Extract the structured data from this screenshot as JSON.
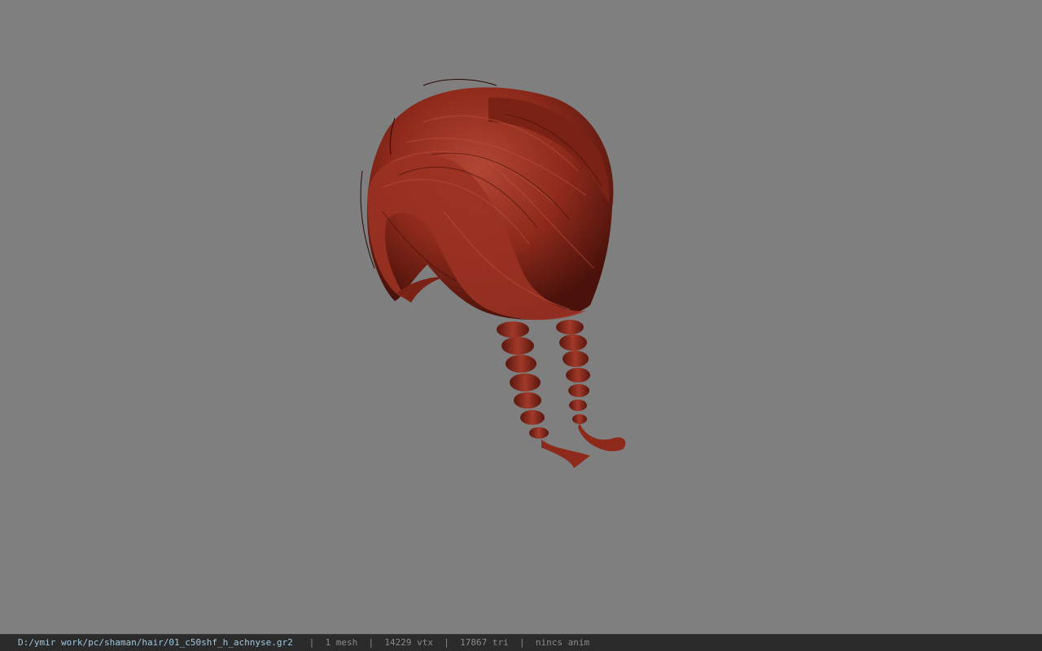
{
  "viewport": {
    "background_color": "#7f7f7f",
    "model": {
      "icon": "hair-model",
      "color": "#8e2a1c",
      "highlight_color": "#b24634",
      "shadow_color": "#4a120b"
    }
  },
  "status_bar": {
    "file_path": "D:/ymir work/pc/shaman/hair/01_c50shf_h_achnyse.gr2",
    "mesh_count": "1 mesh",
    "vertex_count": "14229 vtx",
    "triangle_count": "17867 tri",
    "animation": "nincs anim",
    "separator": "|"
  }
}
